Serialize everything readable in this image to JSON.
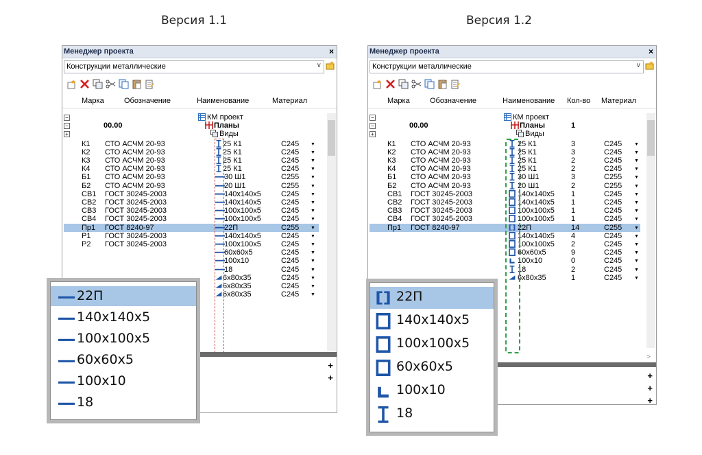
{
  "versions": {
    "left": "Версия 1.1",
    "right": "Версия 1.2"
  },
  "panel": {
    "title": "Менеджер проекта",
    "close": "×",
    "combo_value": "Конструкции металлические",
    "combo_chevron": "∨"
  },
  "left": {
    "headers": {
      "mark": "Марка",
      "designation": "Обозначение",
      "name": "Наименование",
      "material": "Материал"
    },
    "tree": [
      {
        "exp": "⊟",
        "name": "КМ проект"
      },
      {
        "exp": "⊟",
        "mark": "00.00",
        "name": "Планы"
      },
      {
        "exp": "⊞",
        "name": "Виды"
      }
    ],
    "rows": [
      {
        "mark": "К1",
        "desig": "СТО АСЧМ 20-93",
        "name": "25 К1",
        "mat": "С245"
      },
      {
        "mark": "К2",
        "desig": "СТО АСЧМ 20-93",
        "name": "25 К1",
        "mat": "С245"
      },
      {
        "mark": "К3",
        "desig": "СТО АСЧМ 20-93",
        "name": "25 К1",
        "mat": "С245"
      },
      {
        "mark": "К4",
        "desig": "СТО АСЧМ 20-93",
        "name": "25 К1",
        "mat": "С245"
      },
      {
        "mark": "Б1",
        "desig": "СТО АСЧМ 20-93",
        "name": "30 Ш1",
        "mat": "С255"
      },
      {
        "mark": "Б2",
        "desig": "СТО АСЧМ 20-93",
        "name": "20 Ш1",
        "mat": "С255"
      },
      {
        "mark": "СВ1",
        "desig": "ГОСТ 30245-2003",
        "name": "140x140x5",
        "mat": "С245"
      },
      {
        "mark": "СВ2",
        "desig": "ГОСТ 30245-2003",
        "name": "140x140x5",
        "mat": "С245"
      },
      {
        "mark": "СВ3",
        "desig": "ГОСТ 30245-2003",
        "name": "100x100x5",
        "mat": "С245"
      },
      {
        "mark": "СВ4",
        "desig": "ГОСТ 30245-2003",
        "name": "100x100x5",
        "mat": "С245"
      },
      {
        "mark": "Пр1",
        "desig": "ГОСТ 8240-97",
        "name": "22П",
        "mat": "С255"
      },
      {
        "mark": "Р1",
        "desig": "ГОСТ 30245-2003",
        "name": "140x140x5",
        "mat": "С245"
      },
      {
        "mark": "Р2",
        "desig": "ГОСТ 30245-2003",
        "name": "100x100x5",
        "mat": "С245"
      },
      {
        "mark": "",
        "desig": "",
        "name": "60x60x5",
        "mat": "С245"
      },
      {
        "mark": "",
        "desig": "",
        "name": "100x10",
        "mat": "С245"
      },
      {
        "mark": "",
        "desig": "",
        "name": "18",
        "mat": "С245"
      },
      {
        "mark": "",
        "desig": "",
        "name": "6x80x35",
        "mat": "С245"
      },
      {
        "mark": "",
        "desig": "",
        "name": "6x80x35",
        "mat": "С245"
      },
      {
        "mark": "",
        "desig": "",
        "name": "6x80x35",
        "mat": "С245"
      }
    ],
    "zoom": [
      {
        "name": "22П",
        "icon": "dash-icon"
      },
      {
        "name": "140x140x5",
        "icon": "dash-icon"
      },
      {
        "name": "100x100x5",
        "icon": "dash-icon"
      },
      {
        "name": "60x60x5",
        "icon": "dash-icon"
      },
      {
        "name": "100x10",
        "icon": "dash-icon"
      },
      {
        "name": "18",
        "icon": "dash-icon"
      }
    ]
  },
  "right": {
    "headers": {
      "mark": "Марка",
      "designation": "Обозначение",
      "name": "Наименование",
      "qty": "Кол-во",
      "material": "Материал"
    },
    "tree": [
      {
        "exp": "⊟",
        "name": "КМ проект"
      },
      {
        "exp": "⊟",
        "mark": "00.00",
        "name": "Планы",
        "qty": "1"
      },
      {
        "exp": "⊞",
        "name": "Виды"
      }
    ],
    "rows": [
      {
        "mark": "К1",
        "desig": "СТО АСЧМ 20-93",
        "name": "25 К1",
        "qty": "3",
        "mat": "С245"
      },
      {
        "mark": "К2",
        "desig": "СТО АСЧМ 20-93",
        "name": "25 К1",
        "qty": "3",
        "mat": "С245"
      },
      {
        "mark": "К3",
        "desig": "СТО АСЧМ 20-93",
        "name": "25 К1",
        "qty": "2",
        "mat": "С245"
      },
      {
        "mark": "К4",
        "desig": "СТО АСЧМ 20-93",
        "name": "25 К1",
        "qty": "2",
        "mat": "С245"
      },
      {
        "mark": "Б1",
        "desig": "СТО АСЧМ 20-93",
        "name": "30 Ш1",
        "qty": "3",
        "mat": "С255"
      },
      {
        "mark": "Б2",
        "desig": "СТО АСЧМ 20-93",
        "name": "20 Ш1",
        "qty": "2",
        "mat": "С255"
      },
      {
        "mark": "СВ1",
        "desig": "ГОСТ 30245-2003",
        "name": "140x140x5",
        "qty": "1",
        "mat": "С245"
      },
      {
        "mark": "СВ2",
        "desig": "ГОСТ 30245-2003",
        "name": "140x140x5",
        "qty": "1",
        "mat": "С245"
      },
      {
        "mark": "СВ3",
        "desig": "ГОСТ 30245-2003",
        "name": "100x100x5",
        "qty": "1",
        "mat": "С245"
      },
      {
        "mark": "СВ4",
        "desig": "ГОСТ 30245-2003",
        "name": "100x100x5",
        "qty": "1",
        "mat": "С245"
      },
      {
        "mark": "Пр1",
        "desig": "ГОСТ 8240-97",
        "name": "22П",
        "qty": "14",
        "mat": "С255"
      },
      {
        "mark": "",
        "desig": "",
        "name": "140x140x5",
        "qty": "4",
        "mat": "С245"
      },
      {
        "mark": "",
        "desig": "",
        "name": "100x100x5",
        "qty": "2",
        "mat": "С245"
      },
      {
        "mark": "",
        "desig": "",
        "name": "60x60x5",
        "qty": "9",
        "mat": "С245"
      },
      {
        "mark": "",
        "desig": "",
        "name": "100x10",
        "qty": "0",
        "mat": "С245"
      },
      {
        "mark": "",
        "desig": "",
        "name": "18",
        "qty": "2",
        "mat": "С245"
      },
      {
        "mark": "",
        "desig": "",
        "name": "6x80x35",
        "qty": "1",
        "mat": "С245"
      }
    ],
    "zoom": [
      {
        "name": "22П",
        "icon": "channel-icon"
      },
      {
        "name": "140x140x5",
        "icon": "square-tube-icon"
      },
      {
        "name": "100x100x5",
        "icon": "square-tube-icon"
      },
      {
        "name": "60x60x5",
        "icon": "square-tube-icon"
      },
      {
        "name": "100x10",
        "icon": "angle-icon"
      },
      {
        "name": "18",
        "icon": "i-beam-icon"
      }
    ]
  },
  "glyphs": {
    "dropdown": "▼",
    "plus": "+",
    "scroll_up": "^",
    "scroll_down": "∨",
    "scroll_right": ">"
  }
}
